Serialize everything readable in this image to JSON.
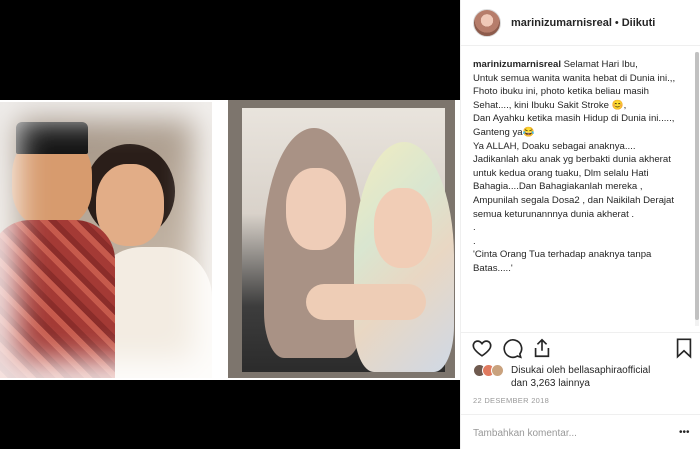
{
  "post": {
    "username": "marinizumarnisreal",
    "follow_status": "Diikuti",
    "separator": "•"
  },
  "caption": {
    "username": "marinizumarnisreal",
    "lines": [
      "Selamat Hari Ibu,",
      "Untuk semua wanita wanita hebat di Dunia ini.,, Fhoto ibuku ini, photo ketika beliau masih Sehat...., kini Ibuku Sakit Stroke 😊,",
      "Dan Ayahku ketika masih Hidup di Dunia ini....., Ganteng ya😂",
      "Ya ALLAH, Doaku sebagai anaknya....",
      "Jadikanlah aku anak yg berbakti dunia akherat untuk kedua orang tuaku, Dlm selalu Hati Bahagia....Dan Bahagiakanlah mereka , Ampunilah segala Dosa2 , dan Naikilah Derajat semua keturunannnya dunia akherat .",
      ".",
      ".",
      "'Cinta Orang Tua terhadap anaknya tanpa Batas.....'"
    ]
  },
  "likes": {
    "line1": "Disukai oleh bellasaphiraofficial",
    "line2": "dan 3,263 lainnya"
  },
  "date": "22 DESEMBER 2018",
  "comment": {
    "placeholder": "Tambahkan komentar...",
    "more": "•••"
  },
  "icons": {
    "like": "heart-icon",
    "comment": "comment-bubble-icon",
    "share": "share-icon",
    "save": "bookmark-icon"
  }
}
